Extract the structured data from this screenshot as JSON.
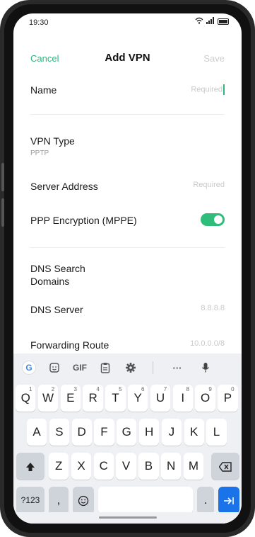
{
  "status": {
    "time": "19:30"
  },
  "header": {
    "cancel": "Cancel",
    "title": "Add VPN",
    "save": "Save"
  },
  "form": {
    "name": {
      "label": "Name",
      "placeholder": "Required"
    },
    "vpn_type": {
      "label": "VPN Type",
      "value": "PPTP"
    },
    "server": {
      "label": "Server Address",
      "placeholder": "Required"
    },
    "encryption": {
      "label": "PPP Encryption (MPPE)",
      "enabled": true
    },
    "dns_search": {
      "label_line1": "DNS Search",
      "label_line2": "Domains"
    },
    "dns_server": {
      "label": "DNS Server",
      "placeholder": "8.8.8.8"
    },
    "forwarding": {
      "label": "Forwarding Route",
      "placeholder": "10.0.0.0/8"
    }
  },
  "keyboard": {
    "toolbar": [
      "G",
      "sticker-icon",
      "GIF",
      "clipboard-icon",
      "gear-icon",
      "···",
      "mic-icon"
    ],
    "row1": [
      {
        "k": "Q",
        "s": "1"
      },
      {
        "k": "W",
        "s": "2"
      },
      {
        "k": "E",
        "s": "3"
      },
      {
        "k": "R",
        "s": "4"
      },
      {
        "k": "T",
        "s": "5"
      },
      {
        "k": "Y",
        "s": "6"
      },
      {
        "k": "U",
        "s": "7"
      },
      {
        "k": "I",
        "s": "8"
      },
      {
        "k": "O",
        "s": "9"
      },
      {
        "k": "P",
        "s": "0"
      }
    ],
    "row2": [
      "A",
      "S",
      "D",
      "F",
      "G",
      "H",
      "J",
      "K",
      "L"
    ],
    "row3": [
      "Z",
      "X",
      "C",
      "V",
      "B",
      "N",
      "M"
    ],
    "sym": "?123",
    "comma": ",",
    "period": "."
  },
  "colors": {
    "accent": "#2db87d",
    "enter": "#1a73e8"
  }
}
